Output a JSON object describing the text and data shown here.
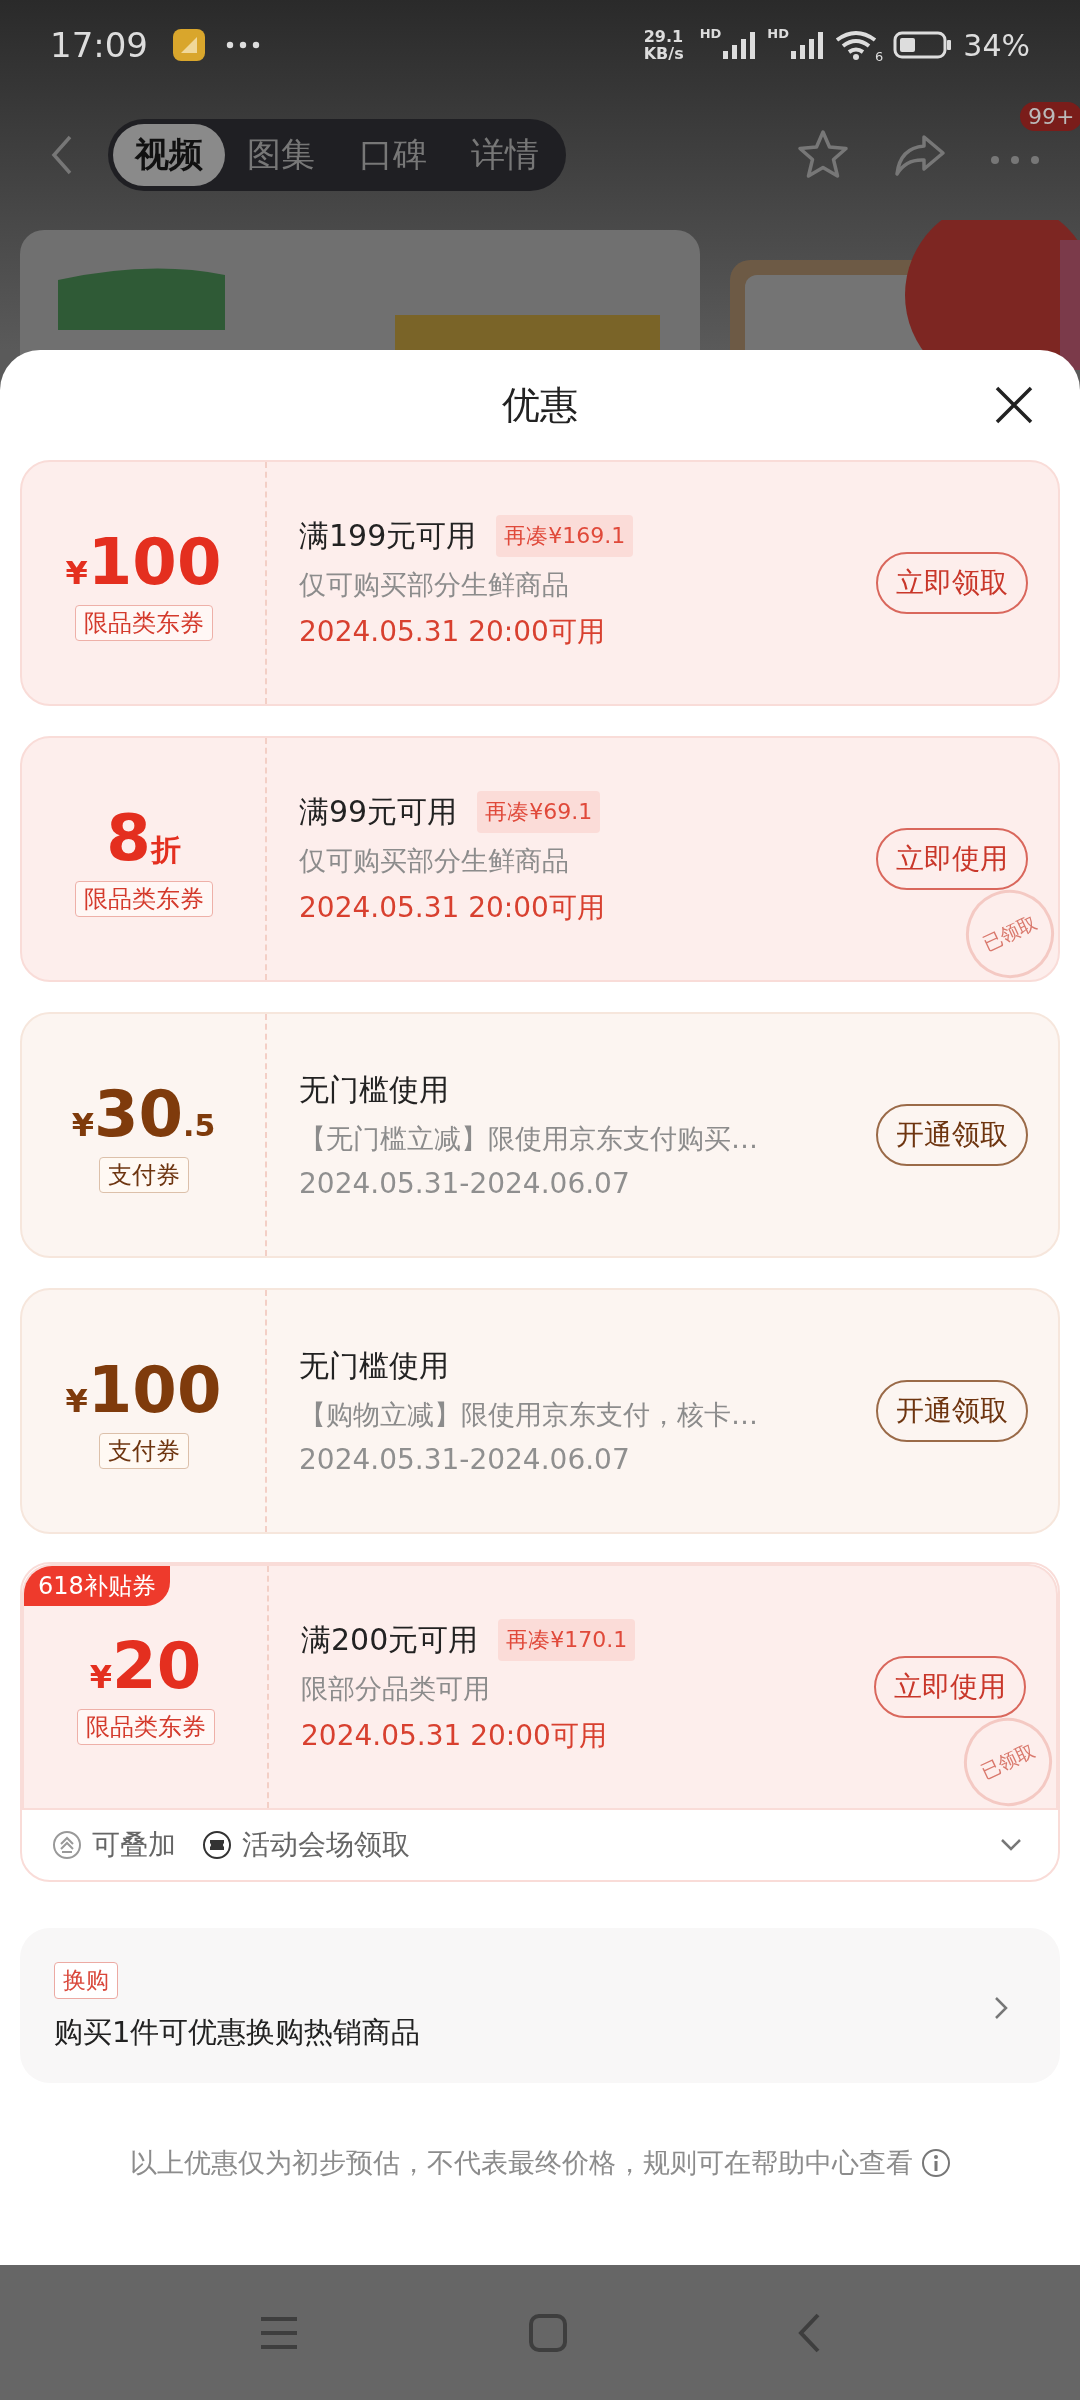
{
  "status_bar": {
    "time": "17:09",
    "speed_value": "29.1",
    "speed_unit": "KB/s",
    "signal_labels": [
      "HD",
      "HD"
    ],
    "wifi_label": "6",
    "battery": "34%"
  },
  "nav": {
    "tabs": [
      {
        "label": "视频",
        "selected": true
      },
      {
        "label": "图集",
        "selected": false
      },
      {
        "label": "口碑",
        "selected": false
      },
      {
        "label": "详情",
        "selected": false
      }
    ],
    "badge": "99+"
  },
  "sheet": {
    "title": "优惠",
    "coupons": [
      {
        "kind": "jd",
        "prefix": "¥",
        "amount": "100",
        "type_tag": "限品类东券",
        "title": "满199元可用",
        "gap_tag": "再凑¥169.1",
        "desc": "仅可购买部分生鲜商品",
        "date": "2024.05.31 20:00可用",
        "button": "立即领取",
        "claimed": false
      },
      {
        "kind": "jd",
        "amount": "8",
        "suffix": "折",
        "type_tag": "限品类东券",
        "title": "满99元可用",
        "gap_tag": "再凑¥69.1",
        "desc": "仅可购买部分生鲜商品",
        "date": "2024.05.31 20:00可用",
        "button": "立即使用",
        "claimed": true,
        "stamp": "已领取"
      },
      {
        "kind": "pay",
        "prefix": "¥",
        "amount": "30",
        "suffix": ".5",
        "type_tag": "支付券",
        "title": "无门槛使用",
        "desc": "【无门槛立减】限使用京东支付购买…",
        "date": "2024.05.31-2024.06.07",
        "button": "开通领取",
        "claimed": false
      },
      {
        "kind": "pay",
        "prefix": "¥",
        "amount": "100",
        "type_tag": "支付券",
        "title": "无门槛使用",
        "desc": "【购物立减】限使用京东支付，核卡…",
        "date": "2024.05.31-2024.06.07",
        "button": "开通领取",
        "claimed": false
      },
      {
        "kind": "jd",
        "prefix": "¥",
        "amount": "20",
        "type_tag": "限品类东券",
        "title": "满200元可用",
        "gap_tag": "再凑¥170.1",
        "desc": "限部分品类可用",
        "date": "2024.05.31 20:00可用",
        "button": "立即使用",
        "claimed": true,
        "stamp": "已领取",
        "corner_badge": "618补贴券",
        "features": [
          {
            "kind": "stack",
            "label": "可叠加"
          },
          {
            "kind": "venue",
            "label": "活动会场领取"
          }
        ]
      }
    ],
    "exchange": {
      "tag": "换购",
      "text": "购买1件可优惠换购热销商品"
    },
    "disclaimer": "以上优惠仅为初步预估，不代表最终价格，规则可在帮助中心查看"
  }
}
